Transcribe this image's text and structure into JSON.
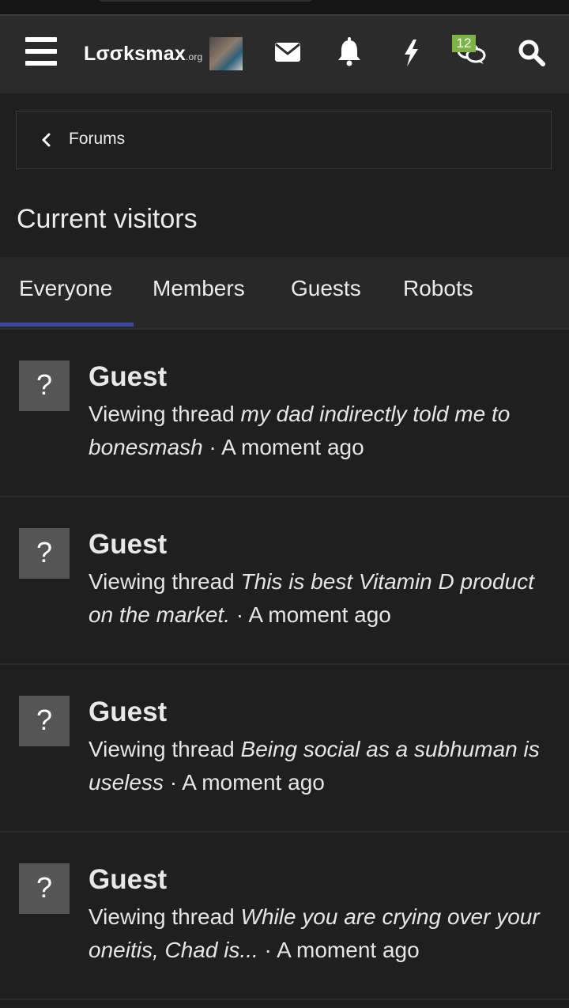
{
  "header": {
    "logo_text": "Lσσksmax",
    "logo_suffix": ".org",
    "notification_count": "12",
    "icons": [
      "menu-icon",
      "envelope-icon",
      "bell-icon",
      "bolt-icon",
      "chat-bubbles-icon",
      "search-icon"
    ]
  },
  "breadcrumb": {
    "label": "Forums"
  },
  "page": {
    "title": "Current visitors"
  },
  "tabs": [
    {
      "label": "Everyone",
      "active": true
    },
    {
      "label": "Members",
      "active": false
    },
    {
      "label": "Guests",
      "active": false
    },
    {
      "label": "Robots",
      "active": false
    }
  ],
  "colors": {
    "accent": "#3b4aa0",
    "badge": "#7cb342",
    "background": "#1f1f1f"
  },
  "visitors": [
    {
      "avatar": "?",
      "name": "Guest",
      "activity": "Viewing thread",
      "thread": "my dad indirectly told me to bonesmash",
      "sep": " · ",
      "time": "A moment ago"
    },
    {
      "avatar": "?",
      "name": "Guest",
      "activity": "Viewing thread",
      "thread": "This is best Vitamin D product on the market.",
      "sep": " · ",
      "time": "A moment ago"
    },
    {
      "avatar": "?",
      "name": "Guest",
      "activity": "Viewing thread",
      "thread": "Being social as a subhuman is useless",
      "sep": " · ",
      "time": "A moment ago"
    },
    {
      "avatar": "?",
      "name": "Guest",
      "activity": "Viewing thread",
      "thread": "While you are crying over your oneitis, Chad is...",
      "sep": " · ",
      "time": "A moment ago"
    }
  ]
}
